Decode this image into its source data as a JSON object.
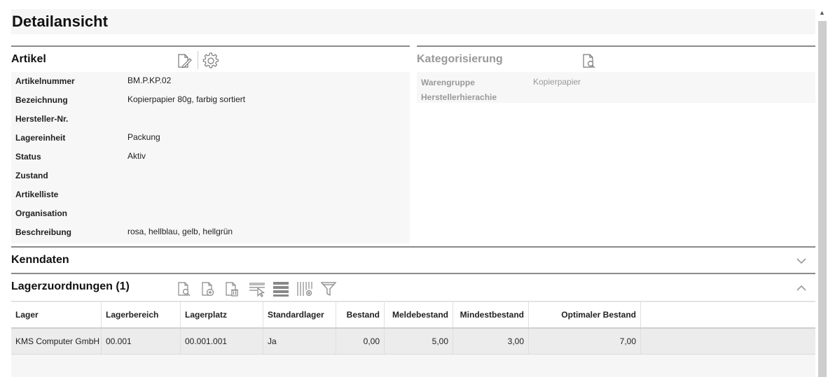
{
  "page": {
    "title": "Detailansicht"
  },
  "artikel": {
    "title": "Artikel",
    "icons": [
      "edit-document-icon",
      "gear-icon"
    ],
    "fields": [
      {
        "label": "Artikelnummer",
        "value": "BM.P.KP.02"
      },
      {
        "label": "Bezeichnung",
        "value": "Kopierpapier 80g, farbig sortiert"
      },
      {
        "label": "Hersteller-Nr.",
        "value": ""
      },
      {
        "label": "Lagereinheit",
        "value": "Packung"
      },
      {
        "label": "Status",
        "value": "Aktiv"
      },
      {
        "label": "Zustand",
        "value": ""
      },
      {
        "label": "Artikelliste",
        "value": ""
      },
      {
        "label": "Organisation",
        "value": ""
      },
      {
        "label": "Beschreibung",
        "value": "rosa, hellblau, gelb, hellgrün"
      }
    ]
  },
  "kategorisierung": {
    "title": "Kategorisierung",
    "icons": [
      "view-document-icon"
    ],
    "fields": [
      {
        "label": "Warengruppe",
        "value": "Kopierpapier"
      },
      {
        "label": "Herstellerhierachie",
        "value": ""
      }
    ]
  },
  "kenndaten": {
    "title": "Kenndaten",
    "state": "collapsed"
  },
  "lagerzuordnungen": {
    "title": "Lagerzuordnungen (1)",
    "state": "expanded",
    "toolbar_icons": [
      "view-document-icon",
      "add-document-icon",
      "delete-document-icon",
      "select-rows-icon",
      "list-view-icon",
      "column-settings-icon",
      "filter-icon"
    ],
    "columns": [
      "Lager",
      "Lagerbereich",
      "Lagerplatz",
      "Standardlager",
      "Bestand",
      "Meldebestand",
      "Mindestbestand",
      "Optimaler Bestand"
    ],
    "rows": [
      [
        "KMS Computer GmbH",
        "00.001",
        "00.001.001",
        "Ja",
        "0,00",
        "5,00",
        "3,00",
        "7,00"
      ]
    ]
  },
  "colors": {
    "section_border": "#8a8a8a",
    "panel_bg": "#f7f7f7",
    "row_bg": "#ececec",
    "muted_text": "#999999"
  }
}
